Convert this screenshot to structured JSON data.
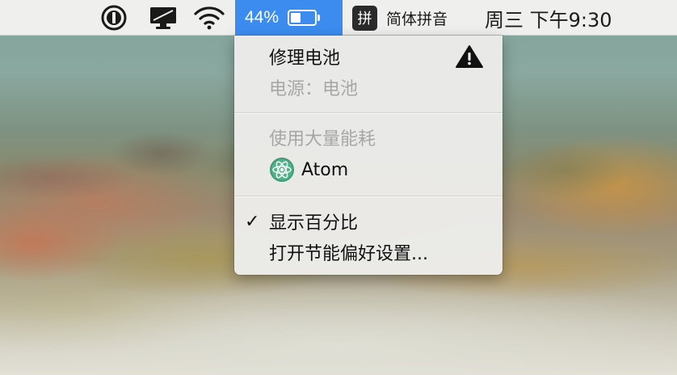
{
  "menubar": {
    "battery_percent": "44%",
    "battery_level": 0.44,
    "input_method_badge": "拼",
    "input_method_label": "简体拼音",
    "clock": "周三 下午9:30",
    "icons": [
      "1password-icon",
      "display-icon",
      "wifi-icon",
      "battery-icon"
    ],
    "colors": {
      "battery_highlight": "#3c8cf0",
      "menubar_bg": "#efefee"
    }
  },
  "battery_menu": {
    "condition_title": "修理电池",
    "power_source": "电源：电池",
    "energy_header": "使用大量能耗",
    "energy_apps": [
      {
        "name": "Atom",
        "icon": "atom-icon"
      }
    ],
    "show_percentage_label": "显示百分比",
    "show_percentage_checked": true,
    "checkmark": "✓",
    "open_energy_prefs_label": "打开节能偏好设置..."
  }
}
